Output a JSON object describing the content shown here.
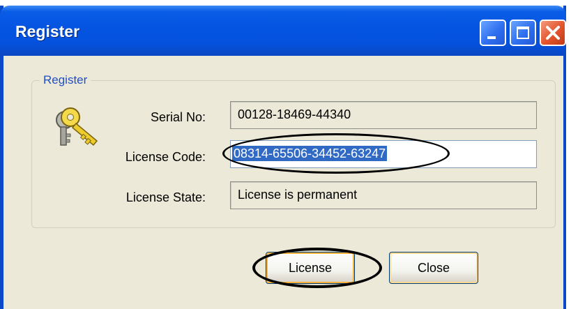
{
  "window": {
    "title": "Register",
    "controls": {
      "minimize": "minimize-icon",
      "maximize": "maximize-icon",
      "close": "close-icon"
    }
  },
  "group": {
    "legend": "Register",
    "icon": "keys-icon"
  },
  "fields": {
    "serial": {
      "label": "Serial No:",
      "value": "00128-18469-44340"
    },
    "license_code": {
      "label": "License Code:",
      "value": "08314-65506-34452-63247",
      "selected": true
    },
    "license_state": {
      "label": "License State:",
      "value": "License is permanent"
    }
  },
  "buttons": {
    "license": "License",
    "close": "Close"
  },
  "colors": {
    "titlebar": "#0555e2",
    "window_bg": "#ece9d8",
    "selection": "#316ac5",
    "legend_text": "#1f4fc8"
  }
}
